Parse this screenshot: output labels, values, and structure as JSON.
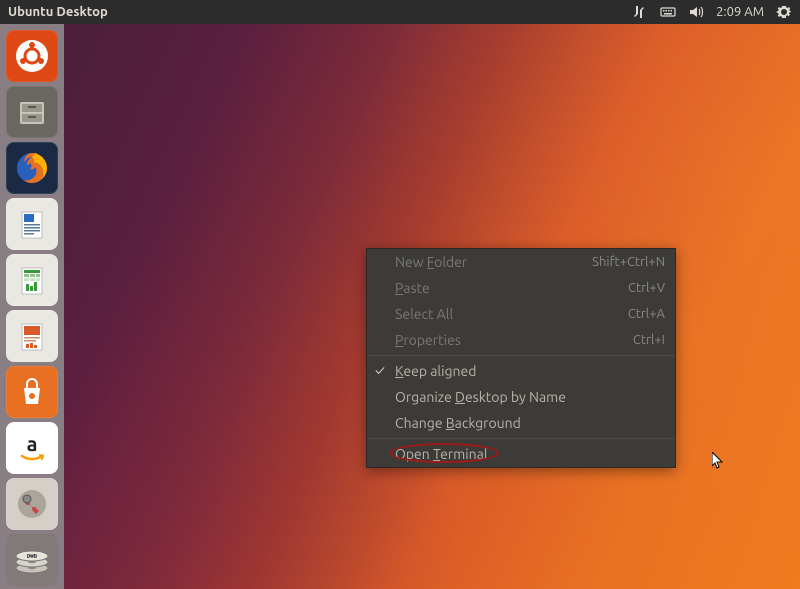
{
  "topbar": {
    "title": "Ubuntu Desktop",
    "time": "2:09 AM"
  },
  "indicators": {
    "network": "network-icon",
    "keyboard": "keyboard-icon",
    "sound": "sound-icon",
    "gear": "gear-icon"
  },
  "launcher": {
    "items": [
      {
        "name": "dash",
        "bg": "#dd4814"
      },
      {
        "name": "files",
        "bg": "#5a5a56"
      },
      {
        "name": "firefox",
        "bg": "#2b3a52"
      },
      {
        "name": "writer",
        "bg": "#e6e6e6"
      },
      {
        "name": "calc",
        "bg": "#e6e6e6"
      },
      {
        "name": "impress",
        "bg": "#e6e6e6"
      },
      {
        "name": "software",
        "bg": "#e87022"
      },
      {
        "name": "amazon",
        "bg": "#ffffff"
      },
      {
        "name": "settings",
        "bg": "#c8c4bc"
      },
      {
        "name": "dvd",
        "bg": "#b8b4ac"
      }
    ]
  },
  "context_menu": {
    "items": [
      {
        "label": "New Folder",
        "underline": "F",
        "accel": "Shift+Ctrl+N",
        "disabled": true
      },
      {
        "label": "Paste",
        "underline": "P",
        "accel": "Ctrl+V",
        "disabled": true
      },
      {
        "label": "Select All",
        "underline": "",
        "accel": "Ctrl+A",
        "disabled": true
      },
      {
        "label": "Properties",
        "underline": "P",
        "accel": "Ctrl+I",
        "disabled": true
      },
      {
        "sep": true
      },
      {
        "label": "Keep aligned",
        "underline": "K",
        "checked": true
      },
      {
        "label": "Organize Desktop by Name",
        "underline": "D"
      },
      {
        "label": "Change Background",
        "underline": "B"
      },
      {
        "sep": true
      },
      {
        "label": "Open Terminal",
        "underline": "T",
        "highlight": true
      }
    ]
  }
}
